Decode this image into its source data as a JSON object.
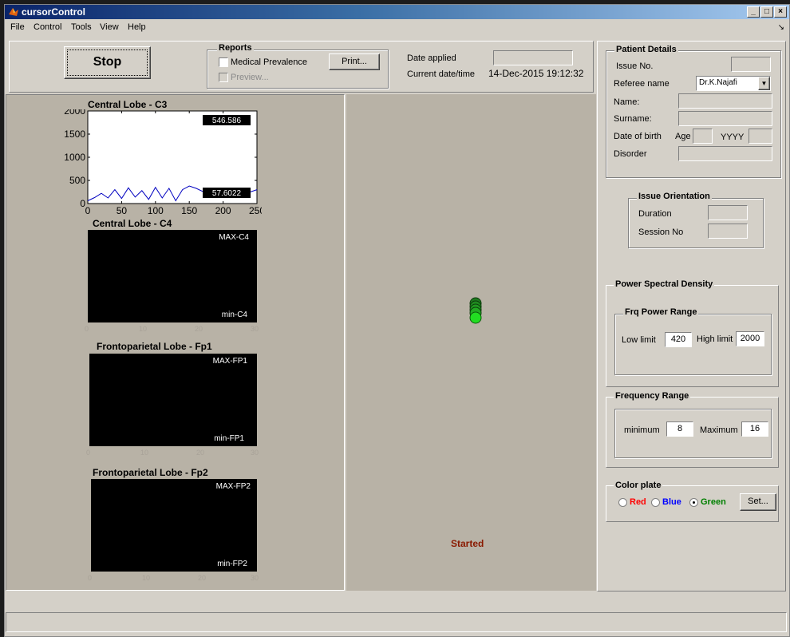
{
  "window": {
    "title": "cursorControl",
    "buttons": {
      "minimize": "_",
      "maximize": "□",
      "close": "×"
    }
  },
  "menu": [
    "File",
    "Control",
    "Tools",
    "View",
    "Help"
  ],
  "toolbar": {
    "stop_label": "Stop",
    "reports": {
      "title": "Reports",
      "medical_prevalence": "Medical Prevalence",
      "preview": "Preview...",
      "print": "Print..."
    },
    "date_applied_label": "Date applied",
    "date_applied_value": "",
    "current_datetime_label": "Current date/time",
    "current_datetime_value": "14-Dec-2015 19:12:32"
  },
  "plots": {
    "c3": {
      "title": "Central Lobe - C3",
      "max_value": "546.586",
      "min_value": "57.6022",
      "chart_data": {
        "type": "line",
        "title": "Central Lobe - C3",
        "xlim": [
          0,
          250
        ],
        "ylim": [
          0,
          2000
        ],
        "xticks": [
          0,
          50,
          100,
          150,
          200,
          250
        ],
        "yticks": [
          0,
          500,
          1000,
          1500,
          2000
        ],
        "series": [
          {
            "color": "#0000c0",
            "x": [
              0,
              10,
              20,
              30,
              40,
              50,
              60,
              70,
              80,
              90,
              100,
              110,
              120,
              130,
              140,
              150,
              160,
              170,
              180,
              190,
              200,
              210,
              220,
              230,
              240,
              250
            ],
            "y": [
              60,
              130,
              220,
              120,
              300,
              110,
              340,
              140,
              280,
              90,
              350,
              120,
              330,
              60,
              300,
              380,
              330,
              260,
              200,
              300,
              250,
              200,
              150,
              200,
              250,
              300
            ]
          }
        ]
      }
    },
    "c4": {
      "title": "Central Lobe - C4",
      "max_tag": "MAX-C4",
      "min_tag": "min-C4"
    },
    "fp1": {
      "title": "Frontoparietal Lobe - Fp1",
      "max_tag": "MAX-FP1",
      "min_tag": "min-FP1"
    },
    "fp2": {
      "title": "Frontoparietal Lobe - Fp2",
      "max_tag": "MAX-FP2",
      "min_tag": "min-FP2"
    },
    "tick_labels": [
      "0",
      "10",
      "20",
      "30"
    ]
  },
  "status_text": "Started",
  "cursor_color": "#22dd22",
  "patient": {
    "title": "Patient Details",
    "issue_no_label": "Issue No.",
    "referee_label": "Referee name",
    "referee_value": "Dr.K.Najafi",
    "name_label": "Name:",
    "surname_label": "Surname:",
    "dob_label": "Date of birth",
    "age_label": "Age",
    "yyyy_label": "YYYY",
    "disorder_label": "Disorder"
  },
  "orientation": {
    "title": "Issue Orientation",
    "duration_label": "Duration",
    "session_label": "Session No"
  },
  "psd": {
    "title": "Power Spectral Density",
    "range_title": "Frq Power Range",
    "low_label": "Low limit",
    "low_value": "420",
    "high_label": "High limit",
    "high_value": "2000"
  },
  "freq": {
    "title": "Frequency Range",
    "min_label": "minimum",
    "min_value": "8",
    "max_label": "Maximum",
    "max_value": "16"
  },
  "color_plate": {
    "title": "Color plate",
    "red": "Red",
    "blue": "Blue",
    "green": "Green",
    "set": "Set...",
    "selected": "Green"
  }
}
